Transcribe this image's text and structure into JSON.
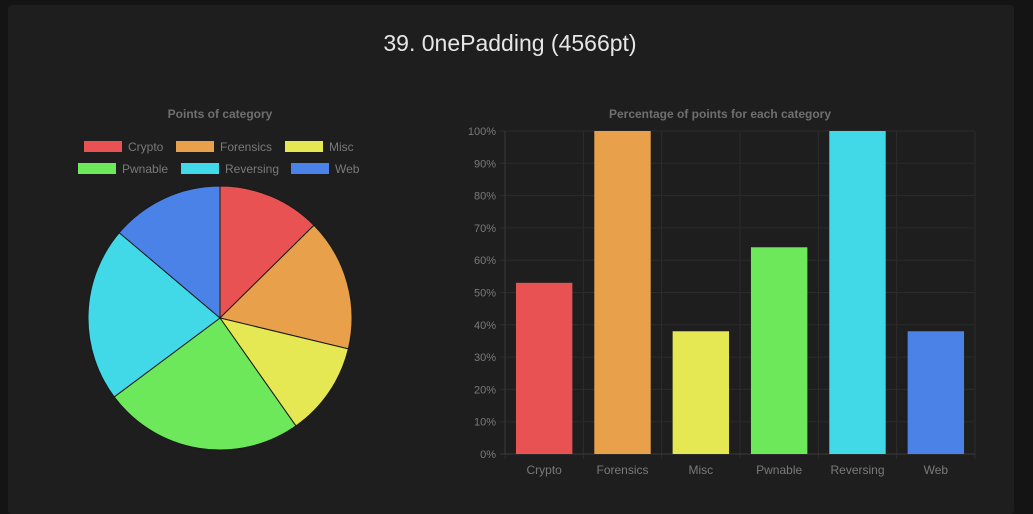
{
  "team": {
    "title": "39. 0nePadding (4566pt)"
  },
  "colors": {
    "Crypto": "#e85252",
    "Forensics": "#e9a04b",
    "Misc": "#e5e852",
    "Pwnable": "#6ee85b",
    "Reversing": "#41d9e8",
    "Web": "#4a82e8"
  },
  "chart_data": [
    {
      "type": "pie",
      "title": "Points of category",
      "categories": [
        "Crypto",
        "Forensics",
        "Misc",
        "Pwnable",
        "Reversing",
        "Web"
      ],
      "values": [
        0.135,
        0.173,
        0.123,
        0.263,
        0.229,
        0.148
      ],
      "legend_position": "top"
    },
    {
      "type": "bar",
      "title": "Percentage of points for each category",
      "categories": [
        "Crypto",
        "Forensics",
        "Misc",
        "Pwnable",
        "Reversing",
        "Web"
      ],
      "values": [
        53,
        100,
        38,
        64,
        100,
        38
      ],
      "ylim": [
        0,
        100
      ],
      "y_tick_labels": [
        "0%",
        "10%",
        "20%",
        "30%",
        "40%",
        "50%",
        "60%",
        "70%",
        "80%",
        "90%",
        "100%"
      ],
      "grid": true
    }
  ]
}
